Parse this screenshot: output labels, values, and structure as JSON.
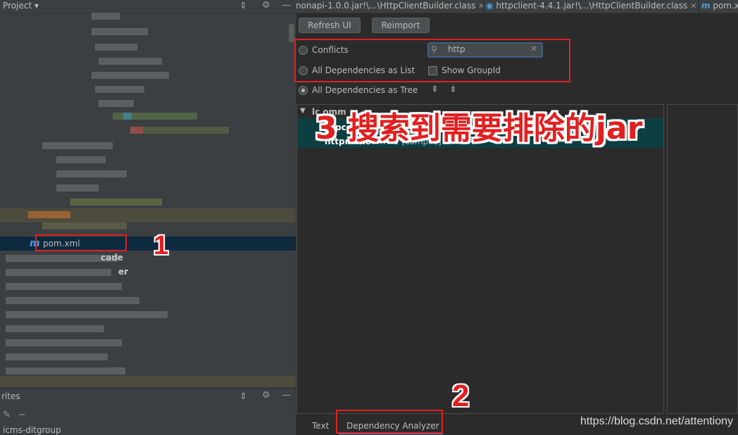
{
  "left_panel": {
    "title": "Project",
    "favorites_title": "rites",
    "favorites_project": "icms-ditgroup",
    "pom_file": "pom.xml",
    "facade_label": "cade",
    "er_label": "er"
  },
  "tabs": [
    {
      "label": "nonapi-1.0.0.jar!\\...\\HttpClientBuilder.class"
    },
    {
      "label": "httpclient-4.4.1.jar!\\...\\HttpClientBuilder.class"
    },
    {
      "label": "pom.x"
    }
  ],
  "toolbar": {
    "refresh_label": "Refresh UI",
    "reimport_label": "Reimport"
  },
  "options": {
    "conflicts_label": "Conflicts",
    "list_label": "All Dependencies as List",
    "tree_label": "All Dependencies as Tree",
    "show_groupid_label": "Show GroupId"
  },
  "search": {
    "value": "http"
  },
  "tree": {
    "row0": "lc   omm",
    "row1_name": "pcor",
    "row1_scope": "[c",
    "row2_name": "httpmime",
    "row2_version": " : 4.4.1 [compile]"
  },
  "annotations": {
    "step1": "1",
    "step2": "2",
    "step3": "3 搜索到需要排除的jar"
  },
  "bottom_tabs": {
    "text_label": "Text",
    "analyzer_label": "Dependency Analyzer"
  },
  "watermark": "https://blog.csdn.net/attentiony",
  "colors": {
    "annotation_red": "#e02020",
    "selection": "#0d3f42",
    "pom_row": "#0d293e"
  }
}
